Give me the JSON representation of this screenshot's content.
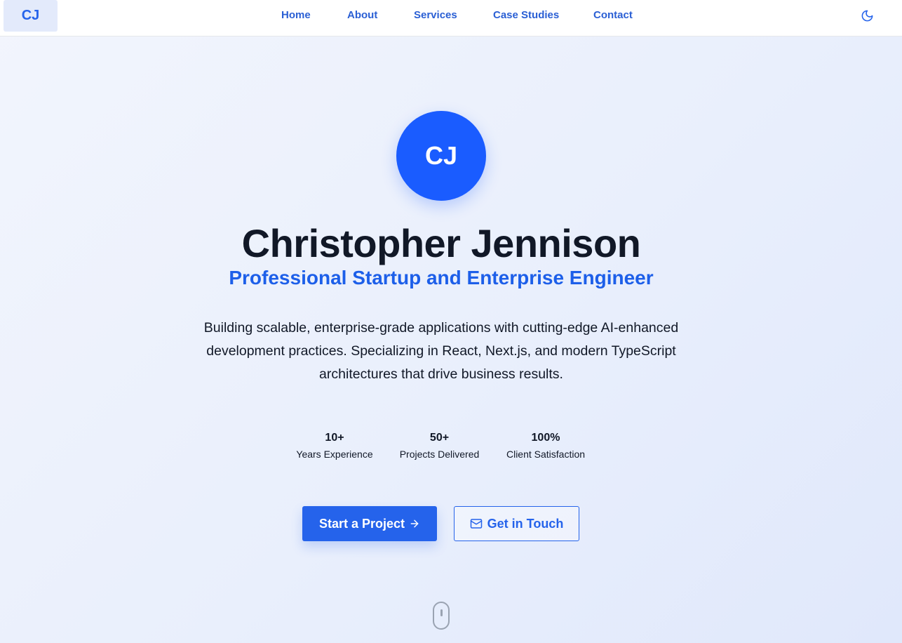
{
  "header": {
    "logo": "CJ",
    "nav": [
      {
        "label": "Home"
      },
      {
        "label": "About"
      },
      {
        "label": "Services"
      },
      {
        "label": "Case Studies"
      },
      {
        "label": "Contact"
      }
    ],
    "theme_toggle_icon": "moon-icon"
  },
  "hero": {
    "avatar_initials": "CJ",
    "name": "Christopher Jennison",
    "subtitle": "Professional Startup and Enterprise Engineer",
    "description": "Building scalable, enterprise-grade applications with cutting-edge AI-enhanced development practices. Specializing in React, Next.js, and modern TypeScript architectures that drive business results.",
    "stats": [
      {
        "value": "10+",
        "label": "Years Experience"
      },
      {
        "value": "50+",
        "label": "Projects Delivered"
      },
      {
        "value": "100%",
        "label": "Client Satisfaction"
      }
    ],
    "primary_button": {
      "label": "Start a Project",
      "icon": "arrow-right-icon"
    },
    "secondary_button": {
      "label": "Get in Touch",
      "icon": "mail-icon"
    },
    "scroll_indicator_icon": "mouse-scroll-icon"
  },
  "colors": {
    "accent": "#2563eb",
    "avatar": "#1a5cff",
    "subtitle": "#1d5fe9",
    "text": "#111827"
  }
}
